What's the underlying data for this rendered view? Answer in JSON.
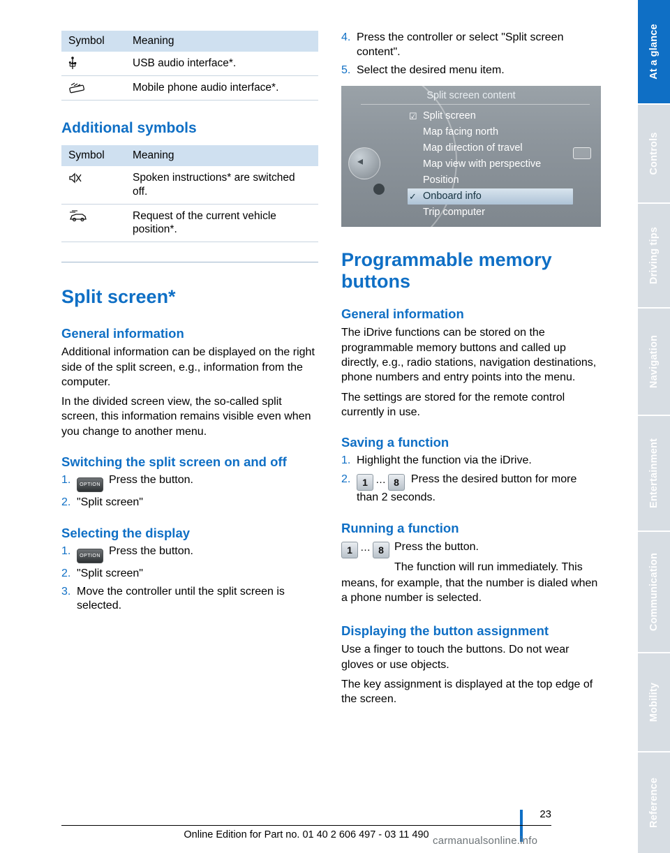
{
  "left": {
    "table1": {
      "headers": [
        "Symbol",
        "Meaning"
      ],
      "rows": [
        {
          "symbol_icon": "usb-icon",
          "meaning": "USB audio interface*."
        },
        {
          "symbol_icon": "mobile-phone-audio-icon",
          "meaning": "Mobile phone audio interface*."
        }
      ]
    },
    "additional_symbols_heading": "Additional symbols",
    "table2": {
      "headers": [
        "Symbol",
        "Meaning"
      ],
      "rows": [
        {
          "symbol_icon": "speaker-muted-icon",
          "meaning": "Spoken instructions* are switched off."
        },
        {
          "symbol_icon": "vehicle-position-icon",
          "meaning": "Request of the current vehicle position*."
        }
      ]
    },
    "split_screen_heading": "Split screen*",
    "general_info_heading": "General information",
    "general_info_p1": "Additional information can be displayed on the right side of the split screen, e.g., information from the computer.",
    "general_info_p2": "In the divided screen view, the so-called split screen, this information remains visible even when you change to another menu.",
    "switching_heading": "Switching the split screen on and off",
    "switching_steps": [
      {
        "num": "1.",
        "icon": "option-button",
        "text": "Press the button."
      },
      {
        "num": "2.",
        "icon": "",
        "text": "\"Split screen\""
      }
    ],
    "selecting_heading": "Selecting the display",
    "selecting_steps": [
      {
        "num": "1.",
        "icon": "option-button",
        "text": "Press the button."
      },
      {
        "num": "2.",
        "icon": "",
        "text": "\"Split screen\""
      },
      {
        "num": "3.",
        "icon": "",
        "text": "Move the controller until the split screen is selected."
      }
    ],
    "option_button_label": "OPTION"
  },
  "right": {
    "top_steps": [
      {
        "num": "4.",
        "text": "Press the controller or select \"Split screen content\"."
      },
      {
        "num": "5.",
        "text": "Select the desired menu item."
      }
    ],
    "idrive": {
      "title": "Split screen content",
      "items": [
        {
          "label": "Split screen",
          "mark": "checkbox",
          "selected": false
        },
        {
          "label": "Map facing north",
          "mark": "",
          "selected": false
        },
        {
          "label": "Map direction of travel",
          "mark": "",
          "selected": false
        },
        {
          "label": "Map view with perspective",
          "mark": "",
          "selected": false
        },
        {
          "label": "Position",
          "mark": "",
          "selected": false
        },
        {
          "label": "Onboard info",
          "mark": "check",
          "selected": true
        },
        {
          "label": "Trip computer",
          "mark": "",
          "selected": false
        }
      ]
    },
    "prog_mem_heading": "Programmable memory buttons",
    "general_info_heading": "General information",
    "general_info_p1": "The iDrive functions can be stored on the programmable memory buttons and called up directly, e.g., radio stations, navigation destinations, phone numbers and entry points into the menu.",
    "general_info_p2": "The settings are stored for the remote control currently in use.",
    "saving_heading": "Saving a function",
    "saving_steps": [
      {
        "num": "1.",
        "text": "Highlight the function via the iDrive."
      },
      {
        "num": "2.",
        "text": "Press the desired button for more than 2 seconds.",
        "key_from": "1",
        "key_dots": "…",
        "key_to": "8"
      }
    ],
    "running_heading": "Running a function",
    "running_line1": "Press the button.",
    "running_line2": "The function will run immediately. This",
    "running_rest": "means, for example, that the number is dialed when a phone number is selected.",
    "running_key_from": "1",
    "running_key_dots": "…",
    "running_key_to": "8",
    "display_assign_heading": "Displaying the button assignment",
    "display_assign_p1": "Use a finger to touch the buttons. Do not wear gloves or use objects.",
    "display_assign_p2": "The key assignment is displayed at the top edge of the screen."
  },
  "rail": {
    "tabs": [
      {
        "label": "At a glance",
        "active": true
      },
      {
        "label": "Controls",
        "active": false
      },
      {
        "label": "Driving tips",
        "active": false
      },
      {
        "label": "Navigation",
        "active": false
      },
      {
        "label": "Entertainment",
        "active": false
      },
      {
        "label": "Communication",
        "active": false
      },
      {
        "label": "Mobility",
        "active": false
      },
      {
        "label": "Reference",
        "active": false
      }
    ]
  },
  "footer": {
    "page_number": "23",
    "text": "Online Edition for Part no. 01 40 2 606 497 - 03 11 490",
    "watermark": "carmanualsonline.info"
  },
  "colors": {
    "accent": "#0f6fc5",
    "table_header": "#cfe0f0",
    "rail_inactive": "#d7dde3"
  }
}
